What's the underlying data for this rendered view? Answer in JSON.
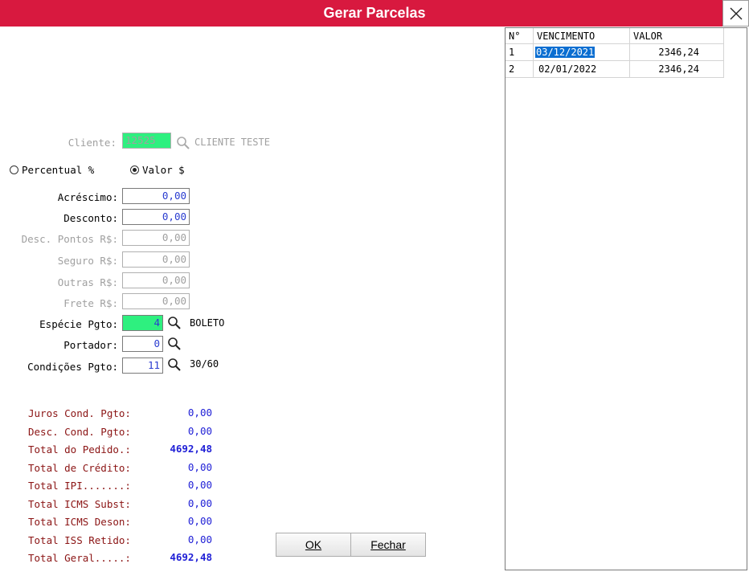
{
  "window": {
    "title": "Gerar Parcelas"
  },
  "form": {
    "cliente": {
      "label": "Cliente:",
      "code": "12525",
      "name": "CLIENTE TESTE"
    },
    "mode": {
      "option_percent": "Percentual %",
      "option_value": "Valor $",
      "selected": "Valor $"
    },
    "fields": [
      {
        "label": "Acréscimo:",
        "value": "0,00"
      },
      {
        "label": "Desconto:",
        "value": "0,00"
      },
      {
        "label": "Desc. Pontos R$:",
        "value": "0,00"
      },
      {
        "label": "Seguro R$:",
        "value": "0,00"
      },
      {
        "label": "Outras R$:",
        "value": "0,00"
      },
      {
        "label": "Frete R$:",
        "value": "0,00"
      }
    ],
    "especie": {
      "label": "Espécie Pgto:",
      "value": "4",
      "desc": "BOLETO"
    },
    "portador": {
      "label": "Portador:",
      "value": "0"
    },
    "condicoes": {
      "label": "Condições Pgto:",
      "value": "11",
      "desc": "30/60"
    }
  },
  "totals": [
    {
      "label": "Juros Cond. Pgto:",
      "value": "0,00"
    },
    {
      "label": "Desc. Cond. Pgto:",
      "value": "0,00"
    },
    {
      "label": "Total do Pedido.:",
      "value": "4692,48"
    },
    {
      "label": "Total de Crédito:",
      "value": "0,00"
    },
    {
      "label": "Total IPI.......:",
      "value": "0,00"
    },
    {
      "label": "Total ICMS Subst:",
      "value": "0,00"
    },
    {
      "label": "Total ICMS Deson:",
      "value": "0,00"
    },
    {
      "label": "Total ISS Retido:",
      "value": "0,00"
    },
    {
      "label": "Total Geral.....:",
      "value": "4692,48"
    }
  ],
  "buttons": {
    "ok": "OK",
    "fechar": "Fechar"
  },
  "grid": {
    "columns": [
      "N°",
      "VENCIMENTO",
      "VALOR"
    ],
    "rows": [
      {
        "n": "1",
        "vencimento": "03/12/2021",
        "valor": "2346,24"
      },
      {
        "n": "2",
        "vencimento": "02/01/2022",
        "valor": "2346,24"
      }
    ],
    "selection_color": "#0a6ed1"
  },
  "colors": {
    "titlebar": "#d8193f",
    "total_label": "#8b1414",
    "total_value": "#1f1fd6",
    "input_highlight": "#2ef07f"
  }
}
